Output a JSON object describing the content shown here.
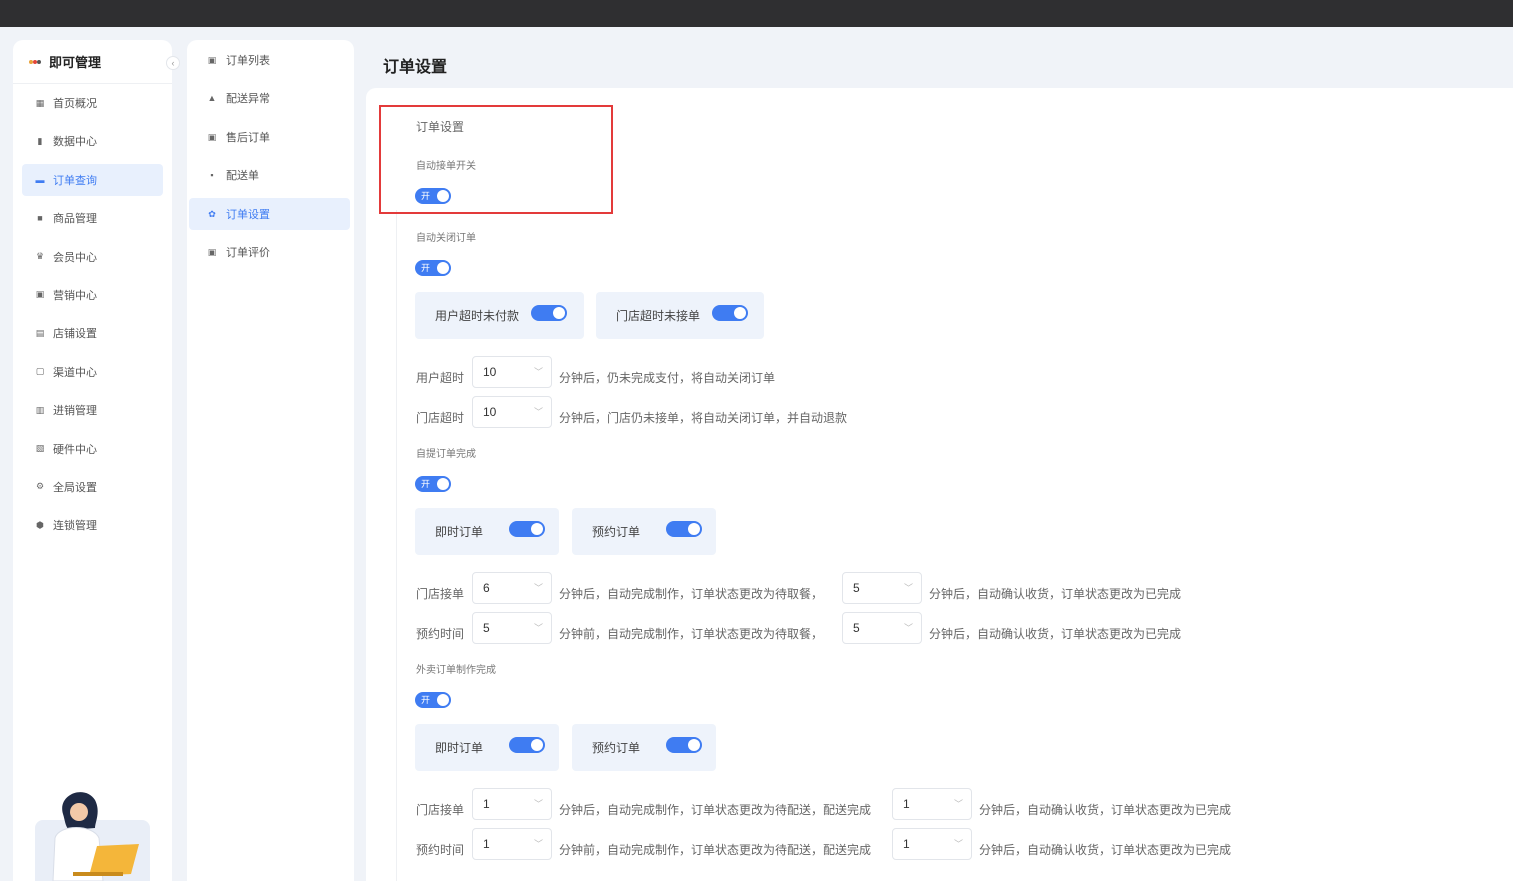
{
  "brand": {
    "title": "即可管理",
    "logo_colors": [
      "#e8a33a",
      "#e3463a",
      "#333333"
    ]
  },
  "sidebar": {
    "items": [
      {
        "label": "首页概况",
        "icon": "grid-icon",
        "glyph": "▦"
      },
      {
        "label": "数据中心",
        "icon": "bar-chart-icon",
        "glyph": "▮"
      },
      {
        "label": "订单查询",
        "icon": "order-icon",
        "glyph": "▬",
        "active": true
      },
      {
        "label": "商品管理",
        "icon": "bag-icon",
        "glyph": "■"
      },
      {
        "label": "会员中心",
        "icon": "crown-icon",
        "glyph": "♛"
      },
      {
        "label": "营销中心",
        "icon": "marketing-icon",
        "glyph": "▣"
      },
      {
        "label": "店铺设置",
        "icon": "store-icon",
        "glyph": "▤"
      },
      {
        "label": "渠道中心",
        "icon": "channel-icon",
        "glyph": "▢"
      },
      {
        "label": "进销管理",
        "icon": "inventory-icon",
        "glyph": "▥"
      },
      {
        "label": "硬件中心",
        "icon": "hardware-icon",
        "glyph": "▧"
      },
      {
        "label": "全局设置",
        "icon": "gear-icon",
        "glyph": "⚙"
      },
      {
        "label": "连锁管理",
        "icon": "shield-icon",
        "glyph": "⬢"
      }
    ]
  },
  "submenu": {
    "items": [
      {
        "label": "订单列表",
        "icon": "list-icon",
        "glyph": "▣"
      },
      {
        "label": "配送异常",
        "icon": "warning-icon",
        "glyph": "▲"
      },
      {
        "label": "售后订单",
        "icon": "after-sale-icon",
        "glyph": "▣"
      },
      {
        "label": "配送单",
        "icon": "truck-icon",
        "glyph": "▪"
      },
      {
        "label": "订单设置",
        "icon": "gear-icon",
        "glyph": "✿",
        "active": true
      },
      {
        "label": "订单评价",
        "icon": "review-icon",
        "glyph": "▣"
      }
    ]
  },
  "page": {
    "title": "订单设置"
  },
  "settings": {
    "section_title": "订单设置",
    "switch_on": "开",
    "auto_accept": {
      "label": "自动接单开关"
    },
    "auto_close": {
      "label": "自动关闭订单",
      "card_user": "用户超时未付款",
      "card_store": "门店超时未接单",
      "row1": {
        "label": "用户超时",
        "value": "10",
        "suffix": "分钟后，仍未完成支付，将自动关闭订单"
      },
      "row2": {
        "label": "门店超时",
        "value": "10",
        "suffix": "分钟后，门店仍未接单，将自动关闭订单，并自动退款"
      }
    },
    "pickup_complete": {
      "label": "自提订单完成",
      "card_instant": "即时订单",
      "card_reserve": "预约订单",
      "row1": {
        "label": "门店接单",
        "value": "6",
        "mid": "分钟后，自动完成制作，订单状态更改为待取餐，",
        "value2": "5",
        "suffix": "分钟后，自动确认收货，订单状态更改为已完成"
      },
      "row2": {
        "label": "预约时间",
        "value": "5",
        "mid": "分钟前，自动完成制作，订单状态更改为待取餐，",
        "value2": "5",
        "suffix": "分钟后，自动确认收货，订单状态更改为已完成"
      }
    },
    "delivery_complete": {
      "label": "外卖订单制作完成",
      "card_instant": "即时订单",
      "card_reserve": "预约订单",
      "row1": {
        "label": "门店接单",
        "value": "1",
        "mid": "分钟后，自动完成制作，订单状态更改为待配送，配送完成",
        "value2": "1",
        "suffix": "分钟后，自动确认收货，订单状态更改为已完成"
      },
      "row2": {
        "label": "预约时间",
        "value": "1",
        "mid": "分钟前，自动完成制作，订单状态更改为待配送，配送完成",
        "value2": "1",
        "suffix": "分钟后，自动确认收货，订单状态更改为已完成"
      }
    }
  },
  "colors": {
    "accent": "#3f7cf2",
    "highlight_border": "#e33a3a",
    "topbar": "#2f2f31"
  }
}
